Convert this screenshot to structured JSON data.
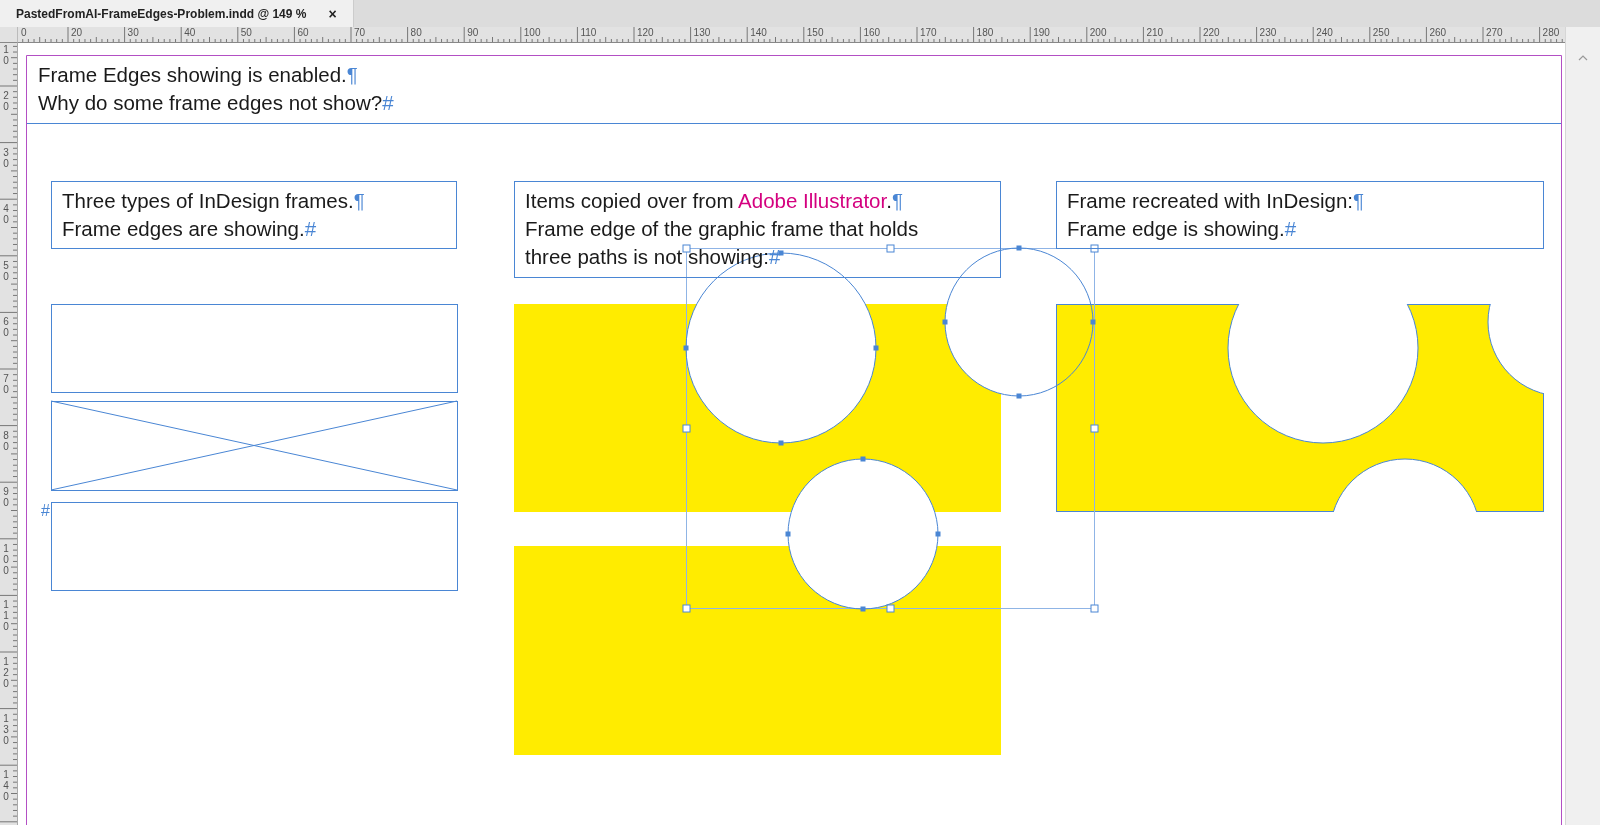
{
  "tab": {
    "title": "PastedFromAI-FrameEdges-Problem.indd @ 149 %",
    "close": "×",
    "selected": true
  },
  "rulers": {
    "horizontal": [
      "0",
      "20",
      "30",
      "40",
      "50",
      "60",
      "70",
      "80",
      "90",
      "100",
      "110",
      "120",
      "130",
      "140",
      "150",
      "160",
      "170",
      "180",
      "190",
      "200",
      "210",
      "220",
      "230",
      "240",
      "250",
      "260",
      "270",
      "280"
    ],
    "vertical": [
      "10",
      "20",
      "30",
      "40",
      "50",
      "60",
      "70",
      "80",
      "90",
      "100",
      "110",
      "120",
      "130",
      "140"
    ]
  },
  "header_frame": {
    "paragraphs": [
      {
        "runs": [
          {
            "text": "Frame Edges showing is enabled."
          }
        ],
        "end_mark": "¶"
      },
      {
        "runs": [
          {
            "text": "Why do some frame edges not show?"
          }
        ],
        "end_mark": "#"
      }
    ]
  },
  "text_frames": [
    {
      "paragraphs": [
        {
          "runs": [
            {
              "text": "Three types of InDesign frames."
            }
          ],
          "end_mark": "¶"
        },
        {
          "runs": [
            {
              "text": "Frame edges are showing."
            }
          ],
          "end_mark": "#"
        }
      ]
    },
    {
      "paragraphs": [
        {
          "runs": [
            {
              "text": "Items copied over from "
            },
            {
              "text": "Adobe Illustrator",
              "color": "#d4007f"
            },
            {
              "text": "."
            }
          ],
          "end_mark": "¶"
        },
        {
          "runs": [
            {
              "text": "Frame edge of the graphic frame that holds three paths is not showing:"
            }
          ],
          "end_mark": "#"
        }
      ]
    },
    {
      "paragraphs": [
        {
          "runs": [
            {
              "text": "Frame recreated with InDesign:"
            }
          ],
          "end_mark": "¶"
        },
        {
          "runs": [
            {
              "text": "Frame edge is showing."
            }
          ],
          "end_mark": "#"
        }
      ]
    }
  ],
  "empty_frames": [
    {
      "kind": "frame"
    },
    {
      "kind": "graphic"
    },
    {
      "kind": "frame",
      "end_mark": "#"
    }
  ]
}
